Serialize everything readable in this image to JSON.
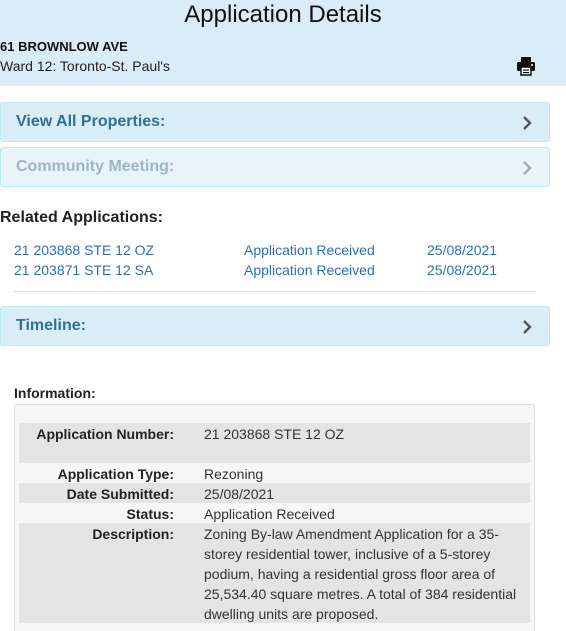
{
  "header": {
    "title": "Application Details",
    "address": "61 BROWNLOW AVE",
    "ward": "Ward 12: Toronto-St. Paul's",
    "print_icon": "printer-icon"
  },
  "panels": {
    "view_all_properties": "View All Properties:",
    "community_meeting": "Community Meeting:",
    "timeline": "Timeline:"
  },
  "related": {
    "title": "Related Applications:",
    "items": [
      {
        "number": "21 203868 STE 12 OZ",
        "status": "Application Received",
        "date": "25/08/2021"
      },
      {
        "number": "21 203871 STE 12 SA",
        "status": "Application Received",
        "date": "25/08/2021"
      }
    ]
  },
  "information": {
    "title": "Information:",
    "rows": [
      {
        "label": "Application Number:",
        "value": "21 203868 STE 12 OZ"
      },
      {
        "label": "Application Type:",
        "value": "Rezoning"
      },
      {
        "label": "Date Submitted:",
        "value": "25/08/2021"
      },
      {
        "label": "Status:",
        "value": "Application Received"
      },
      {
        "label": "Description:",
        "value": "Zoning By-law Amendment Application for a 35-storey residential tower, inclusive of a 5-storey podium, having a residential gross floor area of 25,534.40 square metres. A total of 384 residential dwelling units are proposed."
      }
    ]
  },
  "colors": {
    "header_bg": "#d9edf7",
    "panel_text": "#31708f",
    "link": "#2f6fb0"
  }
}
